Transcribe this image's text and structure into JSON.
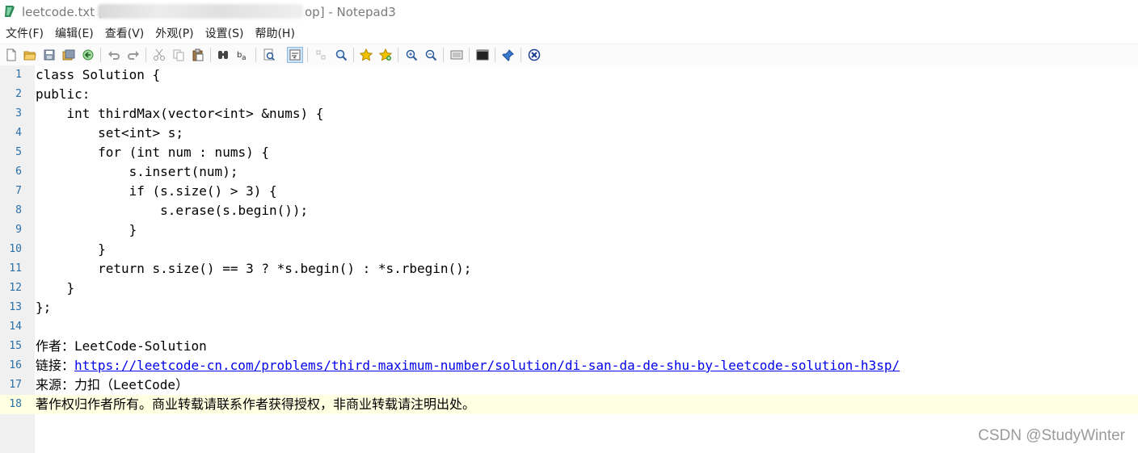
{
  "window": {
    "title_left": "leetcode.txt [",
    "title_right": "op] - Notepad3"
  },
  "menu": [
    {
      "label": "文件(F)"
    },
    {
      "label": "编辑(E)"
    },
    {
      "label": "查看(V)"
    },
    {
      "label": "外观(P)"
    },
    {
      "label": "设置(S)"
    },
    {
      "label": "帮助(H)"
    }
  ],
  "toolbar": {
    "icons": [
      "new-file-icon",
      "open-folder-icon",
      "save-icon",
      "save-all-icon",
      "revert-icon",
      "undo-icon",
      "redo-icon",
      "cut-icon",
      "copy-icon",
      "paste-icon",
      "find-icon",
      "replace-icon",
      "goto-icon",
      "word-wrap-icon",
      "select-icon",
      "zoom-find-icon",
      "favorite-icon",
      "add-favorite-icon",
      "zoom-in-icon",
      "zoom-out-icon",
      "view-icon",
      "console-icon",
      "pin-icon",
      "close-doc-icon"
    ]
  },
  "editor": {
    "lines": [
      {
        "num": "1",
        "text": "class Solution {"
      },
      {
        "num": "2",
        "text": "public:"
      },
      {
        "num": "3",
        "text": "    int thirdMax(vector<int> &nums) {"
      },
      {
        "num": "4",
        "text": "        set<int> s;"
      },
      {
        "num": "5",
        "text": "        for (int num : nums) {"
      },
      {
        "num": "6",
        "text": "            s.insert(num);"
      },
      {
        "num": "7",
        "text": "            if (s.size() > 3) {"
      },
      {
        "num": "8",
        "text": "                s.erase(s.begin());"
      },
      {
        "num": "9",
        "text": "            }"
      },
      {
        "num": "10",
        "text": "        }"
      },
      {
        "num": "11",
        "text": "        return s.size() == 3 ? *s.begin() : *s.rbegin();"
      },
      {
        "num": "12",
        "text": "    }"
      },
      {
        "num": "13",
        "text": "};"
      },
      {
        "num": "14",
        "text": ""
      },
      {
        "num": "15",
        "text": "作者：LeetCode-Solution"
      },
      {
        "num": "16",
        "prefix": "链接：",
        "link": "https://leetcode-cn.com/problems/third-maximum-number/solution/di-san-da-de-shu-by-leetcode-solution-h3sp/"
      },
      {
        "num": "17",
        "text": "来源：力扣（LeetCode）"
      },
      {
        "num": "18",
        "text": "著作权归作者所有。商业转载请联系作者获得授权，非商业转载请注明出处。"
      }
    ]
  },
  "watermark": "CSDN @StudyWinter"
}
